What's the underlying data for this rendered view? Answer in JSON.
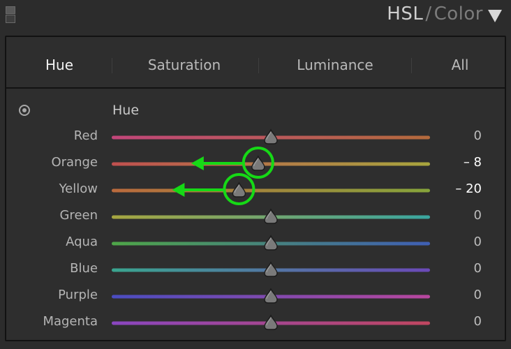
{
  "header": {
    "title_main": "HSL",
    "title_sep": "/",
    "title_secondary": "Color",
    "collapse_icon": "panel-switch-icon",
    "menu_icon": "triangle-down-icon"
  },
  "tabs": [
    {
      "label": "Hue",
      "active": true
    },
    {
      "label": "Saturation",
      "active": false
    },
    {
      "label": "Luminance",
      "active": false
    },
    {
      "label": "All",
      "active": false
    }
  ],
  "section": {
    "label": "Hue",
    "target_icon": "targeted-adjustment-icon"
  },
  "sliders": [
    {
      "label": "Red",
      "value": "0",
      "amount": 0,
      "colors": [
        "#c2467a",
        "#b46a3c"
      ]
    },
    {
      "label": "Orange",
      "value": "– 8",
      "amount": -8,
      "colors": [
        "#c0504f",
        "#a8a53e"
      ]
    },
    {
      "label": "Yellow",
      "value": "– 20",
      "amount": -20,
      "colors": [
        "#bb6a3d",
        "#86a43b"
      ]
    },
    {
      "label": "Green",
      "value": "0",
      "amount": 0,
      "colors": [
        "#a7a640",
        "#3aa6a0"
      ]
    },
    {
      "label": "Aqua",
      "value": "0",
      "amount": 0,
      "colors": [
        "#4ea648",
        "#3f5fb4"
      ]
    },
    {
      "label": "Blue",
      "value": "0",
      "amount": 0,
      "colors": [
        "#3aa58f",
        "#6b49b8"
      ]
    },
    {
      "label": "Purple",
      "value": "0",
      "amount": 0,
      "colors": [
        "#4a4cc0",
        "#b8479e"
      ]
    },
    {
      "label": "Magenta",
      "value": "0",
      "amount": 0,
      "colors": [
        "#8a46c0",
        "#c04660"
      ]
    }
  ],
  "slider_range": [
    -100,
    100
  ],
  "annotations": {
    "color": "#16d916",
    "marked_sliders": [
      "Orange",
      "Yellow"
    ]
  }
}
